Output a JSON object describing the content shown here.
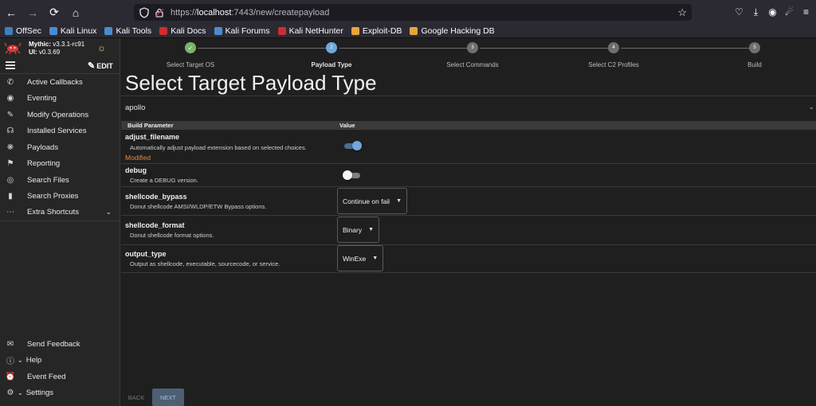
{
  "browser": {
    "url_prefix": "https://",
    "url_host": "localhost",
    "url_rest": ":7443/new/createpayload"
  },
  "bookmarks": [
    {
      "label": "OffSec",
      "color": "#3f7fbf"
    },
    {
      "label": "Kali Linux",
      "color": "#4b8bd0"
    },
    {
      "label": "Kali Tools",
      "color": "#4b8bd0"
    },
    {
      "label": "Kali Docs",
      "color": "#cc2e2e"
    },
    {
      "label": "Kali Forums",
      "color": "#4b8bd0"
    },
    {
      "label": "Kali NetHunter",
      "color": "#cc2e2e"
    },
    {
      "label": "Exploit-DB",
      "color": "#e8a33c"
    },
    {
      "label": "Google Hacking DB",
      "color": "#e8a33c"
    }
  ],
  "sidebar": {
    "brand_name": "Mythic:",
    "brand_version": "v3.3.1-rc91",
    "ui_label": "UI:",
    "ui_version": "v0.3.69",
    "edit_label": "EDIT",
    "items": [
      {
        "label": "Active Callbacks",
        "icon": "phone-icon"
      },
      {
        "label": "Eventing",
        "icon": "play-circle-icon"
      },
      {
        "label": "Modify Operations",
        "icon": "pencil-icon"
      },
      {
        "label": "Installed Services",
        "icon": "headphones-icon"
      },
      {
        "label": "Payloads",
        "icon": "bug-icon"
      },
      {
        "label": "Reporting",
        "icon": "flag-icon"
      },
      {
        "label": "Search Files",
        "icon": "eye-icon"
      },
      {
        "label": "Search Proxies",
        "icon": "socks-icon"
      },
      {
        "label": "Extra Shortcuts",
        "icon": "dots-icon"
      }
    ],
    "bottom": [
      {
        "label": "Send Feedback",
        "icon": "feedback-icon"
      },
      {
        "label": "Help",
        "icon": "help-icon"
      },
      {
        "label": "Event Feed",
        "icon": "alarm-icon"
      },
      {
        "label": "Settings",
        "icon": "settings-icon"
      }
    ]
  },
  "stepper": {
    "steps": [
      {
        "number": "1",
        "label": "Select Target OS",
        "state": "done"
      },
      {
        "number": "2",
        "label": "Payload Type",
        "state": "active"
      },
      {
        "number": "3",
        "label": "Select Commands",
        "state": "pending"
      },
      {
        "number": "4",
        "label": "Select C2 Profiles",
        "state": "pending"
      },
      {
        "number": "5",
        "label": "Build",
        "state": "pending"
      }
    ]
  },
  "main": {
    "title": "Select Target Payload Type",
    "payload_type": "apollo",
    "col_param": "Build Parameter",
    "col_value": "Value"
  },
  "params": [
    {
      "name": "adjust_filename",
      "desc": "Automatically adjust payload extension based on selected choices.",
      "modified": "Modified",
      "type": "toggle",
      "checked": true
    },
    {
      "name": "debug",
      "desc": "Create a DEBUG version.",
      "type": "toggle",
      "checked": false
    },
    {
      "name": "shellcode_bypass",
      "desc": "Donut shellcode AMSI/WLDP/ETW Bypass options.",
      "type": "select",
      "value": "Continue on fail"
    },
    {
      "name": "shellcode_format",
      "desc": "Donut shellcode format options.",
      "type": "select",
      "value": "Binary"
    },
    {
      "name": "output_type",
      "desc": "Output as shellcode, executable, sourcecode, or service.",
      "type": "select",
      "value": "WinExe"
    }
  ],
  "footer": {
    "back": "BACK",
    "next": "NEXT"
  }
}
